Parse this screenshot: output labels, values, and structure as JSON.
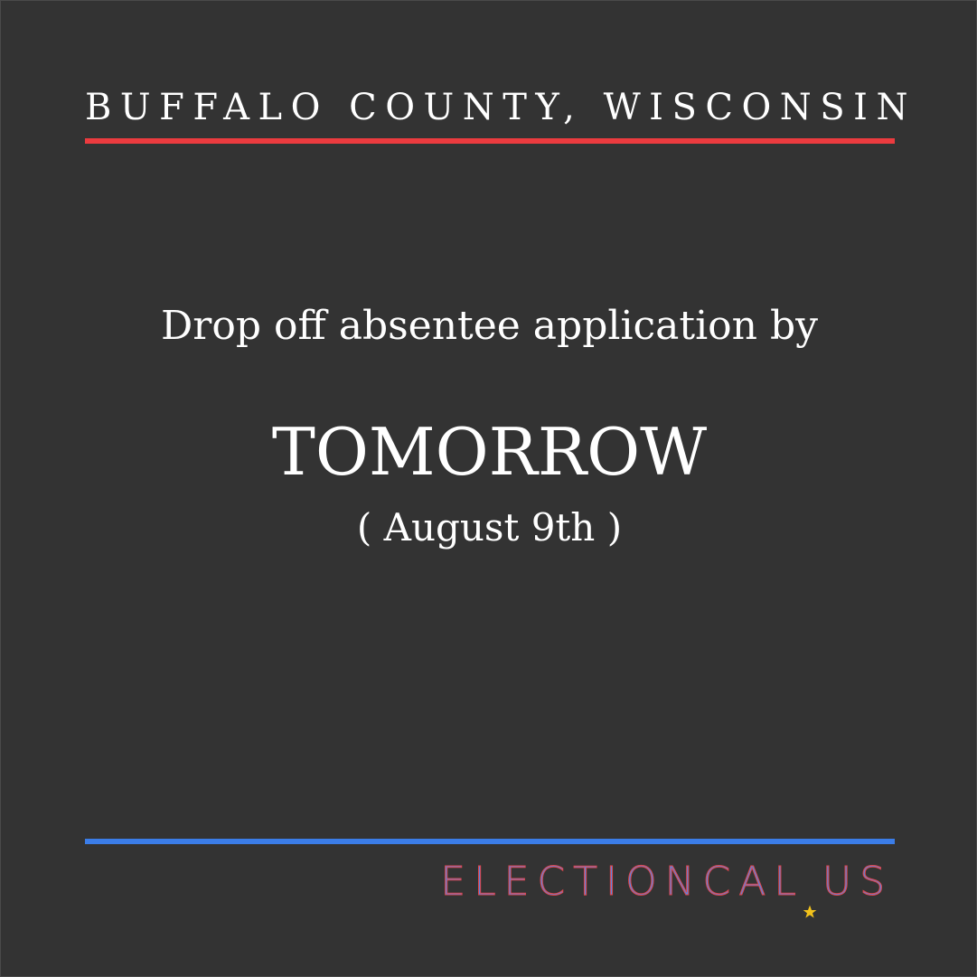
{
  "header": {
    "county": "BUFFALO COUNTY, WISCONSIN"
  },
  "notice": {
    "action": "Drop off absentee application by",
    "deadline": "TOMORROW",
    "date": "( August 9th )"
  },
  "footer": {
    "brand_part_a": "ELECTIONCAL",
    "brand_separator_icon": "star-icon",
    "brand_part_b": "US"
  },
  "colors": {
    "background": "#333333",
    "top_rule": "#ec3b3f",
    "bottom_rule": "#3b7de8",
    "brand_blue": "#5c86de",
    "brand_red": "#e0464d",
    "star": "#f2c21b",
    "text": "#ffffff"
  }
}
